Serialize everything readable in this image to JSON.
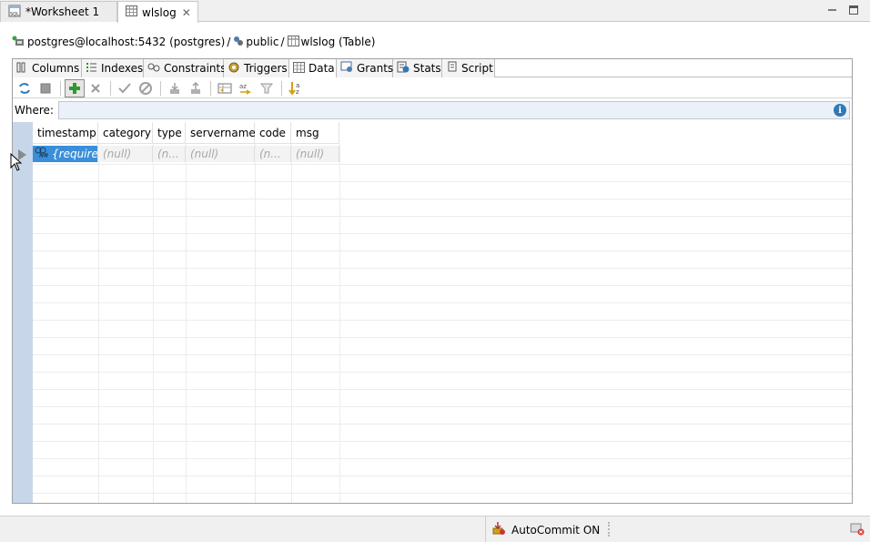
{
  "editor_tabs": [
    {
      "label": "*Worksheet 1",
      "icon": "sql-worksheet-icon",
      "active": false
    },
    {
      "label": "wlslog",
      "icon": "table-icon",
      "active": true,
      "close": "✕"
    }
  ],
  "breadcrumb": {
    "connection": "postgres@localhost:5432 (postgres)",
    "schema": "public",
    "table": "wlslog (Table)",
    "separator": "/"
  },
  "subtabs": [
    "Columns",
    "Indexes",
    "Constraints",
    "Triggers",
    "Data",
    "Grants",
    "Stats",
    "Script"
  ],
  "active_subtab": "Data",
  "toolbar": {
    "buttons": [
      "refresh",
      "stop",
      "insert-row",
      "delete-row",
      "commit",
      "rollback",
      "export",
      "import",
      "fetch-all",
      "sort",
      "filter",
      "sort-az"
    ]
  },
  "where": {
    "label": "Where:",
    "value": "",
    "info": "i"
  },
  "grid": {
    "columns": [
      "timestamp",
      "category",
      "type",
      "servername",
      "code",
      "msg"
    ],
    "rows": [
      [
        "{required",
        "(null)",
        "(n...",
        "(null)",
        "(n...",
        "(null)"
      ]
    ],
    "nn_badge": "NN"
  },
  "status": {
    "autocommit": "AutoCommit ON"
  },
  "colors": {
    "selection": "#3b8fd9",
    "row_header": "#c7d7e9",
    "where_bg": "#eaf1fb",
    "info_blue": "#2f79b6",
    "add_green": "#2e9a2e"
  }
}
